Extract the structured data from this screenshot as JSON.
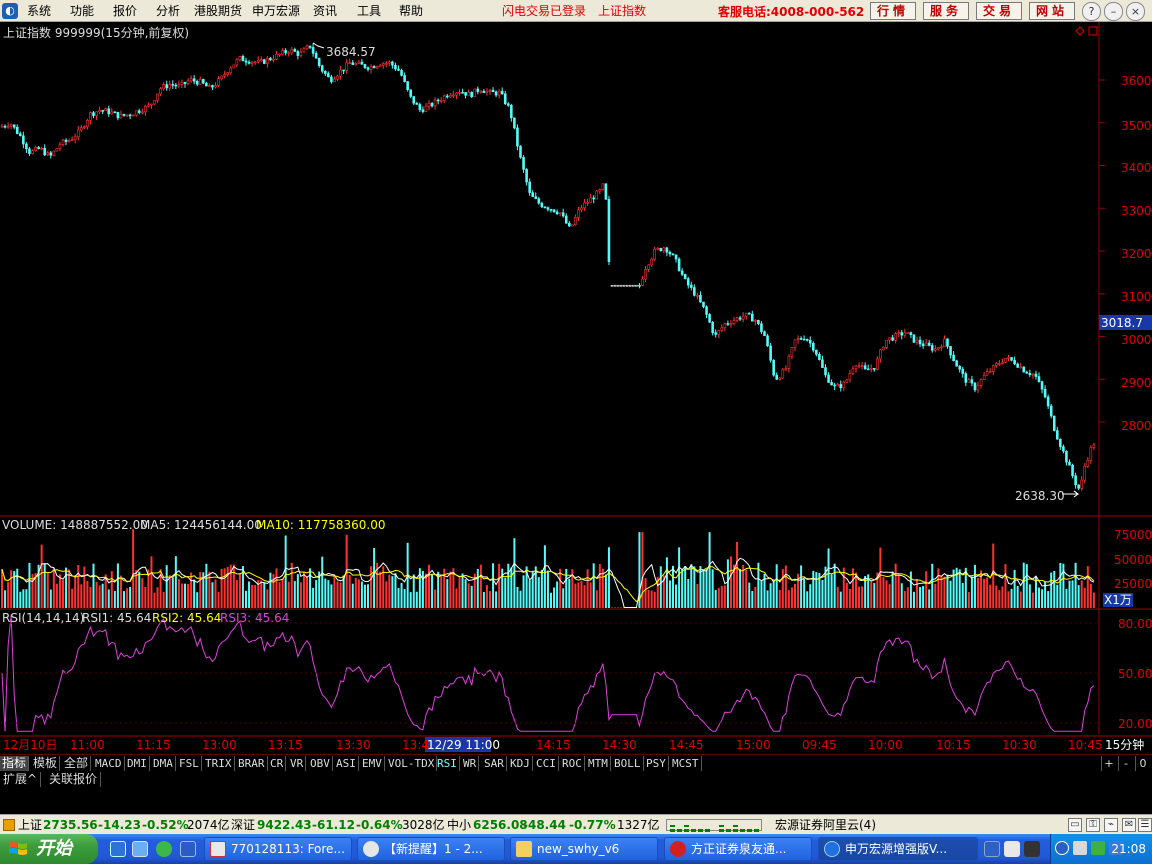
{
  "menu": {
    "items": [
      "系统",
      "功能",
      "报价",
      "分析",
      "港股期货",
      "申万宏源",
      "资讯",
      "工具",
      "帮助"
    ],
    "status_login": "闪电交易已登录",
    "status_index": "上证指数",
    "hotline": "客服电话:4008-000-562",
    "nav_buttons": [
      "行情",
      "服务",
      "交易",
      "网站"
    ]
  },
  "chart": {
    "header": "上证指数 999999(15分钟,前复权)",
    "high_label": "3684.57",
    "low_label": "2638.30",
    "price_tag": "3018.7",
    "y_ticks": [
      "3600",
      "3500",
      "3400",
      "3300",
      "3200",
      "3100",
      "3000",
      "2900",
      "2800"
    ],
    "volume_header": {
      "volume": "VOLUME: 148887552.00",
      "ma5": "MA5: 124456144.00",
      "ma10": "MA10: 117758360.00"
    },
    "volume_ticks": [
      "75000",
      "50000",
      "25000"
    ],
    "volume_unit": "X1万",
    "rsi_header": {
      "label": "RSI(14,14,14)",
      "rsi1": "RSI1: 45.64",
      "rsi2": "RSI2: 45.64",
      "rsi3": "RSI3: 45.64"
    },
    "rsi_ticks": [
      "80.00",
      "50.00",
      "20.00"
    ],
    "time_labels": [
      "12月10日",
      "11:00",
      "11:15",
      "13:00",
      "13:15",
      "13:30",
      "13:4",
      "12/29 11:00",
      "14:15",
      "14:30",
      "14:45",
      "15:00",
      "09:45",
      "10:00",
      "10:15",
      "10:30",
      "10:45"
    ],
    "period_label": "15分钟"
  },
  "chart_data": {
    "type": "candlestick",
    "title": "上证指数 999999(15分钟,前复权)",
    "ylim": [
      2600,
      3720
    ],
    "high": 3684.57,
    "low": 2638.3,
    "last": 3018.7,
    "close_path": [
      [
        0,
        3490
      ],
      [
        10,
        3500
      ],
      [
        20,
        3470
      ],
      [
        30,
        3430
      ],
      [
        40,
        3440
      ],
      [
        50,
        3420
      ],
      [
        60,
        3450
      ],
      [
        70,
        3460
      ],
      [
        80,
        3480
      ],
      [
        90,
        3520
      ],
      [
        100,
        3530
      ],
      [
        110,
        3525
      ],
      [
        120,
        3515
      ],
      [
        130,
        3520
      ],
      [
        140,
        3530
      ],
      [
        150,
        3540
      ],
      [
        160,
        3580
      ],
      [
        170,
        3590
      ],
      [
        180,
        3585
      ],
      [
        190,
        3600
      ],
      [
        200,
        3595
      ],
      [
        210,
        3580
      ],
      [
        220,
        3600
      ],
      [
        230,
        3630
      ],
      [
        240,
        3650
      ],
      [
        250,
        3645
      ],
      [
        260,
        3640
      ],
      [
        270,
        3650
      ],
      [
        280,
        3660
      ],
      [
        290,
        3670
      ],
      [
        300,
        3660
      ],
      [
        310,
        3680
      ],
      [
        320,
        3630
      ],
      [
        330,
        3600
      ],
      [
        340,
        3620
      ],
      [
        350,
        3640
      ],
      [
        360,
        3635
      ],
      [
        370,
        3630
      ],
      [
        380,
        3640
      ],
      [
        390,
        3640
      ],
      [
        400,
        3620
      ],
      [
        410,
        3560
      ],
      [
        420,
        3530
      ],
      [
        430,
        3540
      ],
      [
        440,
        3555
      ],
      [
        450,
        3570
      ],
      [
        460,
        3575
      ],
      [
        470,
        3565
      ],
      [
        480,
        3580
      ],
      [
        490,
        3570
      ],
      [
        500,
        3570
      ],
      [
        510,
        3530
      ],
      [
        520,
        3420
      ],
      [
        530,
        3330
      ],
      [
        540,
        3310
      ],
      [
        550,
        3300
      ],
      [
        560,
        3290
      ],
      [
        570,
        3250
      ],
      [
        580,
        3300
      ],
      [
        590,
        3320
      ],
      [
        600,
        3340
      ],
      [
        605,
        3360
      ],
      [
        610,
        3120
      ],
      [
        640,
        3120
      ],
      [
        645,
        3160
      ],
      [
        655,
        3200
      ],
      [
        665,
        3210
      ],
      [
        675,
        3180
      ],
      [
        685,
        3130
      ],
      [
        695,
        3100
      ],
      [
        705,
        3060
      ],
      [
        715,
        3000
      ],
      [
        725,
        3030
      ],
      [
        735,
        3040
      ],
      [
        745,
        3050
      ],
      [
        755,
        3040
      ],
      [
        765,
        3000
      ],
      [
        775,
        2900
      ],
      [
        785,
        2920
      ],
      [
        795,
        2990
      ],
      [
        805,
        3000
      ],
      [
        815,
        2970
      ],
      [
        825,
        2910
      ],
      [
        835,
        2880
      ],
      [
        845,
        2890
      ],
      [
        855,
        2940
      ],
      [
        865,
        2920
      ],
      [
        875,
        2930
      ],
      [
        885,
        2990
      ],
      [
        895,
        3000
      ],
      [
        905,
        3010
      ],
      [
        915,
        2990
      ],
      [
        925,
        2980
      ],
      [
        935,
        2970
      ],
      [
        945,
        2990
      ],
      [
        955,
        2940
      ],
      [
        965,
        2900
      ],
      [
        975,
        2880
      ],
      [
        985,
        2910
      ],
      [
        995,
        2930
      ],
      [
        1005,
        2950
      ],
      [
        1015,
        2940
      ],
      [
        1025,
        2920
      ],
      [
        1035,
        2910
      ],
      [
        1045,
        2860
      ],
      [
        1055,
        2780
      ],
      [
        1065,
        2720
      ],
      [
        1075,
        2660
      ],
      [
        1080,
        2640
      ],
      [
        1085,
        2700
      ],
      [
        1093,
        2750
      ]
    ]
  },
  "tabs": [
    "指标",
    "模板",
    "全部",
    "MACD",
    "DMI",
    "DMA",
    "FSL",
    "TRIX",
    "BRAR",
    "CR",
    "VR",
    "OBV",
    "ASI",
    "EMV",
    "VOL-TDX",
    "RSI",
    "WR",
    "SAR",
    "KDJ",
    "CCI",
    "ROC",
    "MTM",
    "BOLL",
    "PSY",
    "MCST"
  ],
  "tab_controls": [
    "+",
    "-",
    "0"
  ],
  "subtabs": [
    "扩展^",
    "关联报价"
  ],
  "ticker": {
    "sh_name": "上证",
    "sh_value": "2735.56",
    "sh_change": "-14.23",
    "sh_pct": "-0.52%",
    "sh_amount": "2074亿",
    "sz_name": "深证",
    "sz_value": "9422.43",
    "sz_change": "-61.12",
    "sz_pct": "-0.64%",
    "sz_amount": "3028亿",
    "zx_name": "中小",
    "zx_value": "6256.08",
    "zx_change": "-48.44",
    "zx_pct": "-0.77%",
    "zx_amount": "1327亿",
    "server": "宏源证券阿里云(4)"
  },
  "taskbar": {
    "start": "开始",
    "tasks": [
      "770128113: Fore...",
      "【新提醒】1 - 2...",
      "new_swhy_v6",
      "方正证券泉友通...",
      "申万宏源增强版V..."
    ],
    "clock": "21:08"
  }
}
